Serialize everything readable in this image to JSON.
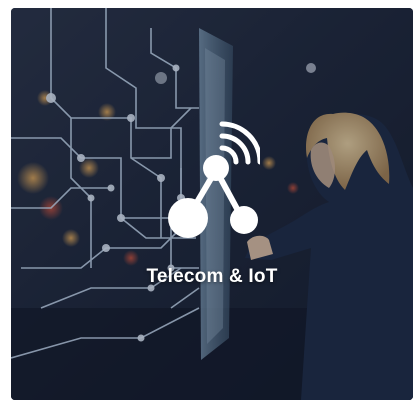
{
  "card": {
    "title": "Telecom & IoT",
    "icon": "iot-network-icon",
    "image": "woman-touching-digital-circuit-screen",
    "colors": {
      "overlay": "#141c2e",
      "circuit_lines": "#cfe6ff",
      "title_text": "#ffffff"
    }
  }
}
